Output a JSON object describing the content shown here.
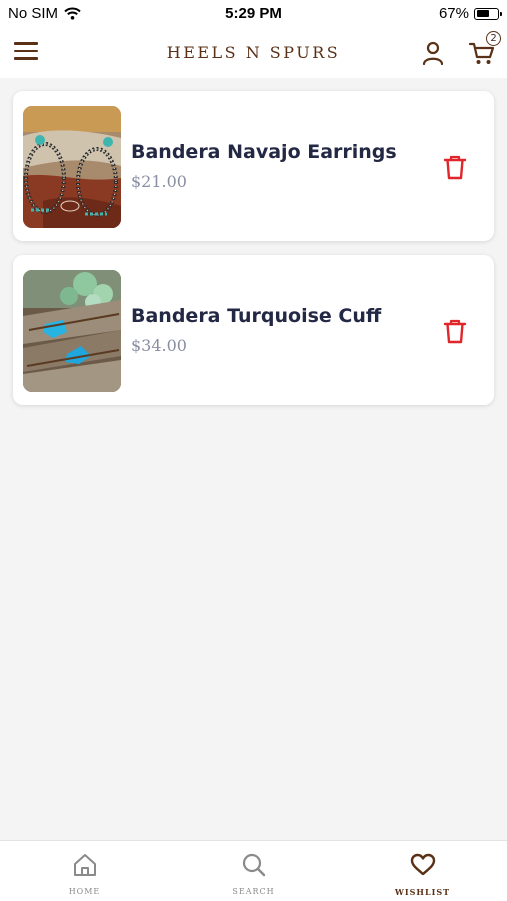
{
  "status_bar": {
    "carrier": "No SIM",
    "time": "5:29 PM",
    "battery_percent": "67%",
    "battery_level": 0.67
  },
  "header": {
    "brand": "HEELS N SPURS",
    "cart_count": "2",
    "icons": [
      "menu-icon",
      "user-icon",
      "cart-icon"
    ]
  },
  "wishlist": {
    "items": [
      {
        "name": "Bandera Navajo Earrings",
        "price": "$21.00",
        "image": "earrings-photo",
        "action_icon": "trash-icon"
      },
      {
        "name": "Bandera Turquoise Cuff",
        "price": "$34.00",
        "image": "turquoise-cuff-photo",
        "action_icon": "trash-icon"
      }
    ]
  },
  "bottom_nav": {
    "items": [
      {
        "label": "HOME",
        "icon": "home-icon",
        "active": false
      },
      {
        "label": "SEARCH",
        "icon": "search-icon",
        "active": false
      },
      {
        "label": "WISHLIST",
        "icon": "heart-icon",
        "active": true
      }
    ]
  },
  "colors": {
    "brand_brown": "#5a3016",
    "delete_red": "#e0262b",
    "background": "#f4f4f5",
    "title_text": "#232845",
    "price_text": "#8a8ea2"
  }
}
